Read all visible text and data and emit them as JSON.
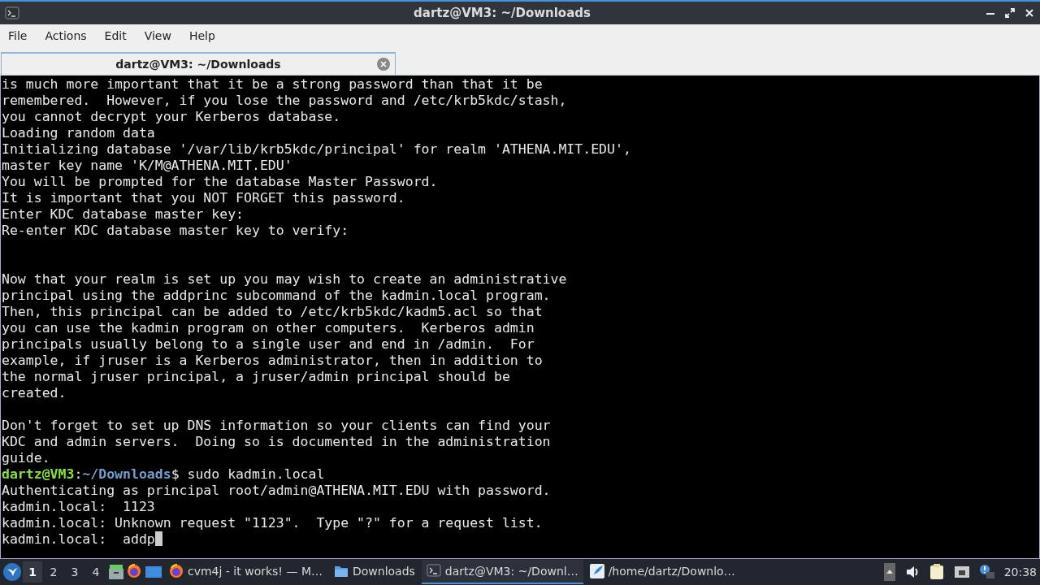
{
  "window": {
    "title": "dartz@VM3: ~/Downloads"
  },
  "menu": [
    "File",
    "Actions",
    "Edit",
    "View",
    "Help"
  ],
  "tabs": [
    {
      "label": "dartz@VM3: ~/Downloads",
      "selected": true
    }
  ],
  "terminal": {
    "lines": [
      {
        "kind": "text",
        "text": "is much more important that it be a strong password than that it be"
      },
      {
        "kind": "text",
        "text": "remembered.  However, if you lose the password and /etc/krb5kdc/stash,"
      },
      {
        "kind": "text",
        "text": "you cannot decrypt your Kerberos database."
      },
      {
        "kind": "text",
        "text": "Loading random data"
      },
      {
        "kind": "text",
        "text": "Initializing database '/var/lib/krb5kdc/principal' for realm 'ATHENA.MIT.EDU',"
      },
      {
        "kind": "text",
        "text": "master key name 'K/M@ATHENA.MIT.EDU'"
      },
      {
        "kind": "text",
        "text": "You will be prompted for the database Master Password."
      },
      {
        "kind": "text",
        "text": "It is important that you NOT FORGET this password."
      },
      {
        "kind": "text",
        "text": "Enter KDC database master key:"
      },
      {
        "kind": "text",
        "text": "Re-enter KDC database master key to verify:"
      },
      {
        "kind": "blank"
      },
      {
        "kind": "blank"
      },
      {
        "kind": "text",
        "text": "Now that your realm is set up you may wish to create an administrative"
      },
      {
        "kind": "text",
        "text": "principal using the addprinc subcommand of the kadmin.local program."
      },
      {
        "kind": "text",
        "text": "Then, this principal can be added to /etc/krb5kdc/kadm5.acl so that"
      },
      {
        "kind": "text",
        "text": "you can use the kadmin program on other computers.  Kerberos admin"
      },
      {
        "kind": "text",
        "text": "principals usually belong to a single user and end in /admin.  For"
      },
      {
        "kind": "text",
        "text": "example, if jruser is a Kerberos administrator, then in addition to"
      },
      {
        "kind": "text",
        "text": "the normal jruser principal, a jruser/admin principal should be"
      },
      {
        "kind": "text",
        "text": "created."
      },
      {
        "kind": "blank"
      },
      {
        "kind": "text",
        "text": "Don't forget to set up DNS information so your clients can find your"
      },
      {
        "kind": "text",
        "text": "KDC and admin servers.  Doing so is documented in the administration"
      },
      {
        "kind": "text",
        "text": "guide."
      },
      {
        "kind": "prompt",
        "user": "dartz@VM3",
        "separator": ":",
        "path": "~/Downloads",
        "command": "$ sudo kadmin.local"
      },
      {
        "kind": "text",
        "text": "Authenticating as principal root/admin@ATHENA.MIT.EDU with password."
      },
      {
        "kind": "text",
        "text": "kadmin.local:  1123"
      },
      {
        "kind": "text",
        "text": "kadmin.local: Unknown request \"1123\".  Type \"?\" for a request list."
      },
      {
        "kind": "input",
        "text": "kadmin.local:  addp"
      }
    ]
  },
  "taskbar": {
    "workspaces": [
      {
        "label": "1",
        "selected": true
      },
      {
        "label": "2",
        "selected": false
      },
      {
        "label": "3",
        "selected": false
      },
      {
        "label": "4",
        "selected": false
      }
    ],
    "tasks": [
      {
        "kind": "browser",
        "label": "cvm4j - it works! — M…",
        "selected": false
      },
      {
        "kind": "folder",
        "label": "Downloads",
        "selected": false
      },
      {
        "kind": "terminal",
        "label": "dartz@VM3: ~/Downl…",
        "selected": true
      },
      {
        "kind": "editor",
        "label": "/home/dartz/Downlo…",
        "selected": false
      }
    ],
    "clock": "20:38"
  }
}
